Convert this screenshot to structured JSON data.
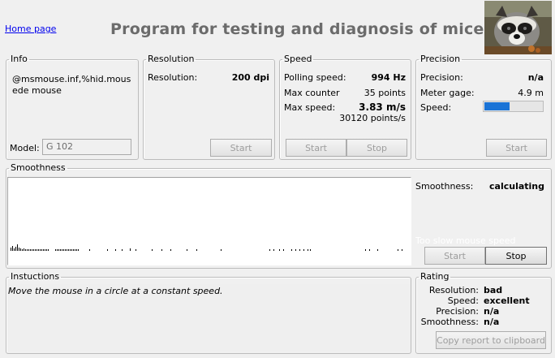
{
  "header": {
    "home_link": "Home page",
    "title": "Program for testing and diagnosis of mice"
  },
  "info": {
    "legend": "Info",
    "driver": "@msmouse.inf,%hid.mousede mouse",
    "model_label": "Model:",
    "model_value": "G 102"
  },
  "resolution": {
    "legend": "Resolution",
    "label": "Resolution:",
    "value": "200 dpi",
    "start": "Start"
  },
  "speed": {
    "legend": "Speed",
    "polling_label": "Polling speed:",
    "polling_value": "994 Hz",
    "counter_label": "Max counter",
    "counter_value": "35 points",
    "max_label": "Max  speed:",
    "max_value": "3.83 m/s",
    "max_points": "30120 points/s",
    "start": "Start",
    "stop": "Stop"
  },
  "precision": {
    "legend": "Precision",
    "label": "Precision:",
    "value": "n/a",
    "gage_label": "Meter gage:",
    "gage_value": "4.9 m",
    "speed_label": "Speed:",
    "speed_level": 0.43,
    "start": "Start"
  },
  "smoothness": {
    "legend": "Smoothness",
    "label": "Smoothness:",
    "value": "calculating",
    "warning": "Too slow mouse speed",
    "start": "Start",
    "stop": "Stop"
  },
  "instructions": {
    "legend": "Instuctions",
    "text": "Move the mouse in a circle at a constant speed."
  },
  "rating": {
    "legend": "Rating",
    "rows": [
      {
        "label": "Resolution:",
        "value": "bad"
      },
      {
        "label": "Speed:",
        "value": "excellent"
      },
      {
        "label": "Precision:",
        "value": "n/a"
      },
      {
        "label": "Smoothness:",
        "value": "n/a"
      }
    ],
    "copy": "Copy report to clipboard"
  },
  "colors": {
    "speed_bar": "#1a73d6",
    "title": "#6b6b6b"
  },
  "icons": {
    "logo": "raccoon-photo"
  }
}
